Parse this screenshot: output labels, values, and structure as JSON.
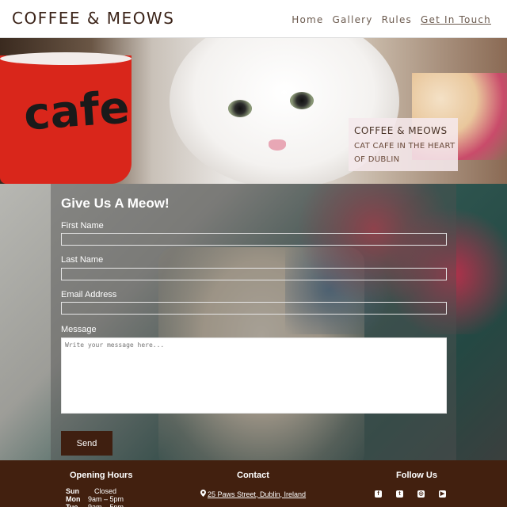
{
  "header": {
    "logo": "COFFEE & MEOWS",
    "nav": [
      {
        "label": "Home"
      },
      {
        "label": "Gallery"
      },
      {
        "label": "Rules"
      },
      {
        "label": "Get In Touch"
      }
    ],
    "active_nav": "Get In Touch"
  },
  "hero": {
    "cup_text": "cafe",
    "tagline_title": "COFFEE & MEOWS",
    "tagline_subtitle": "CAT CAFE IN THE HEART OF DUBLIN"
  },
  "contact_form": {
    "title": "Give Us A Meow!",
    "first_name_label": "First Name",
    "first_name_value": "",
    "last_name_label": "Last Name",
    "last_name_value": "",
    "email_label": "Email Address",
    "email_value": "",
    "message_label": "Message",
    "message_placeholder": "Write your message here...",
    "send_label": "Send"
  },
  "footer": {
    "hours_title": "Opening Hours",
    "hours": [
      {
        "day": "Sun",
        "time": "Closed"
      },
      {
        "day": "Mon",
        "time": "9am – 5pm"
      },
      {
        "day": "Tue",
        "time": "9am – 5pm"
      }
    ],
    "contact_title": "Contact",
    "address": "25 Paws Street, Dublin, Ireland",
    "follow_title": "Follow Us",
    "social": [
      "facebook-icon",
      "twitter-icon",
      "instagram-icon",
      "youtube-icon"
    ]
  },
  "colors": {
    "brand_dark": "#42200f",
    "logo_text": "#3b2318",
    "button": "#3f1f10"
  }
}
